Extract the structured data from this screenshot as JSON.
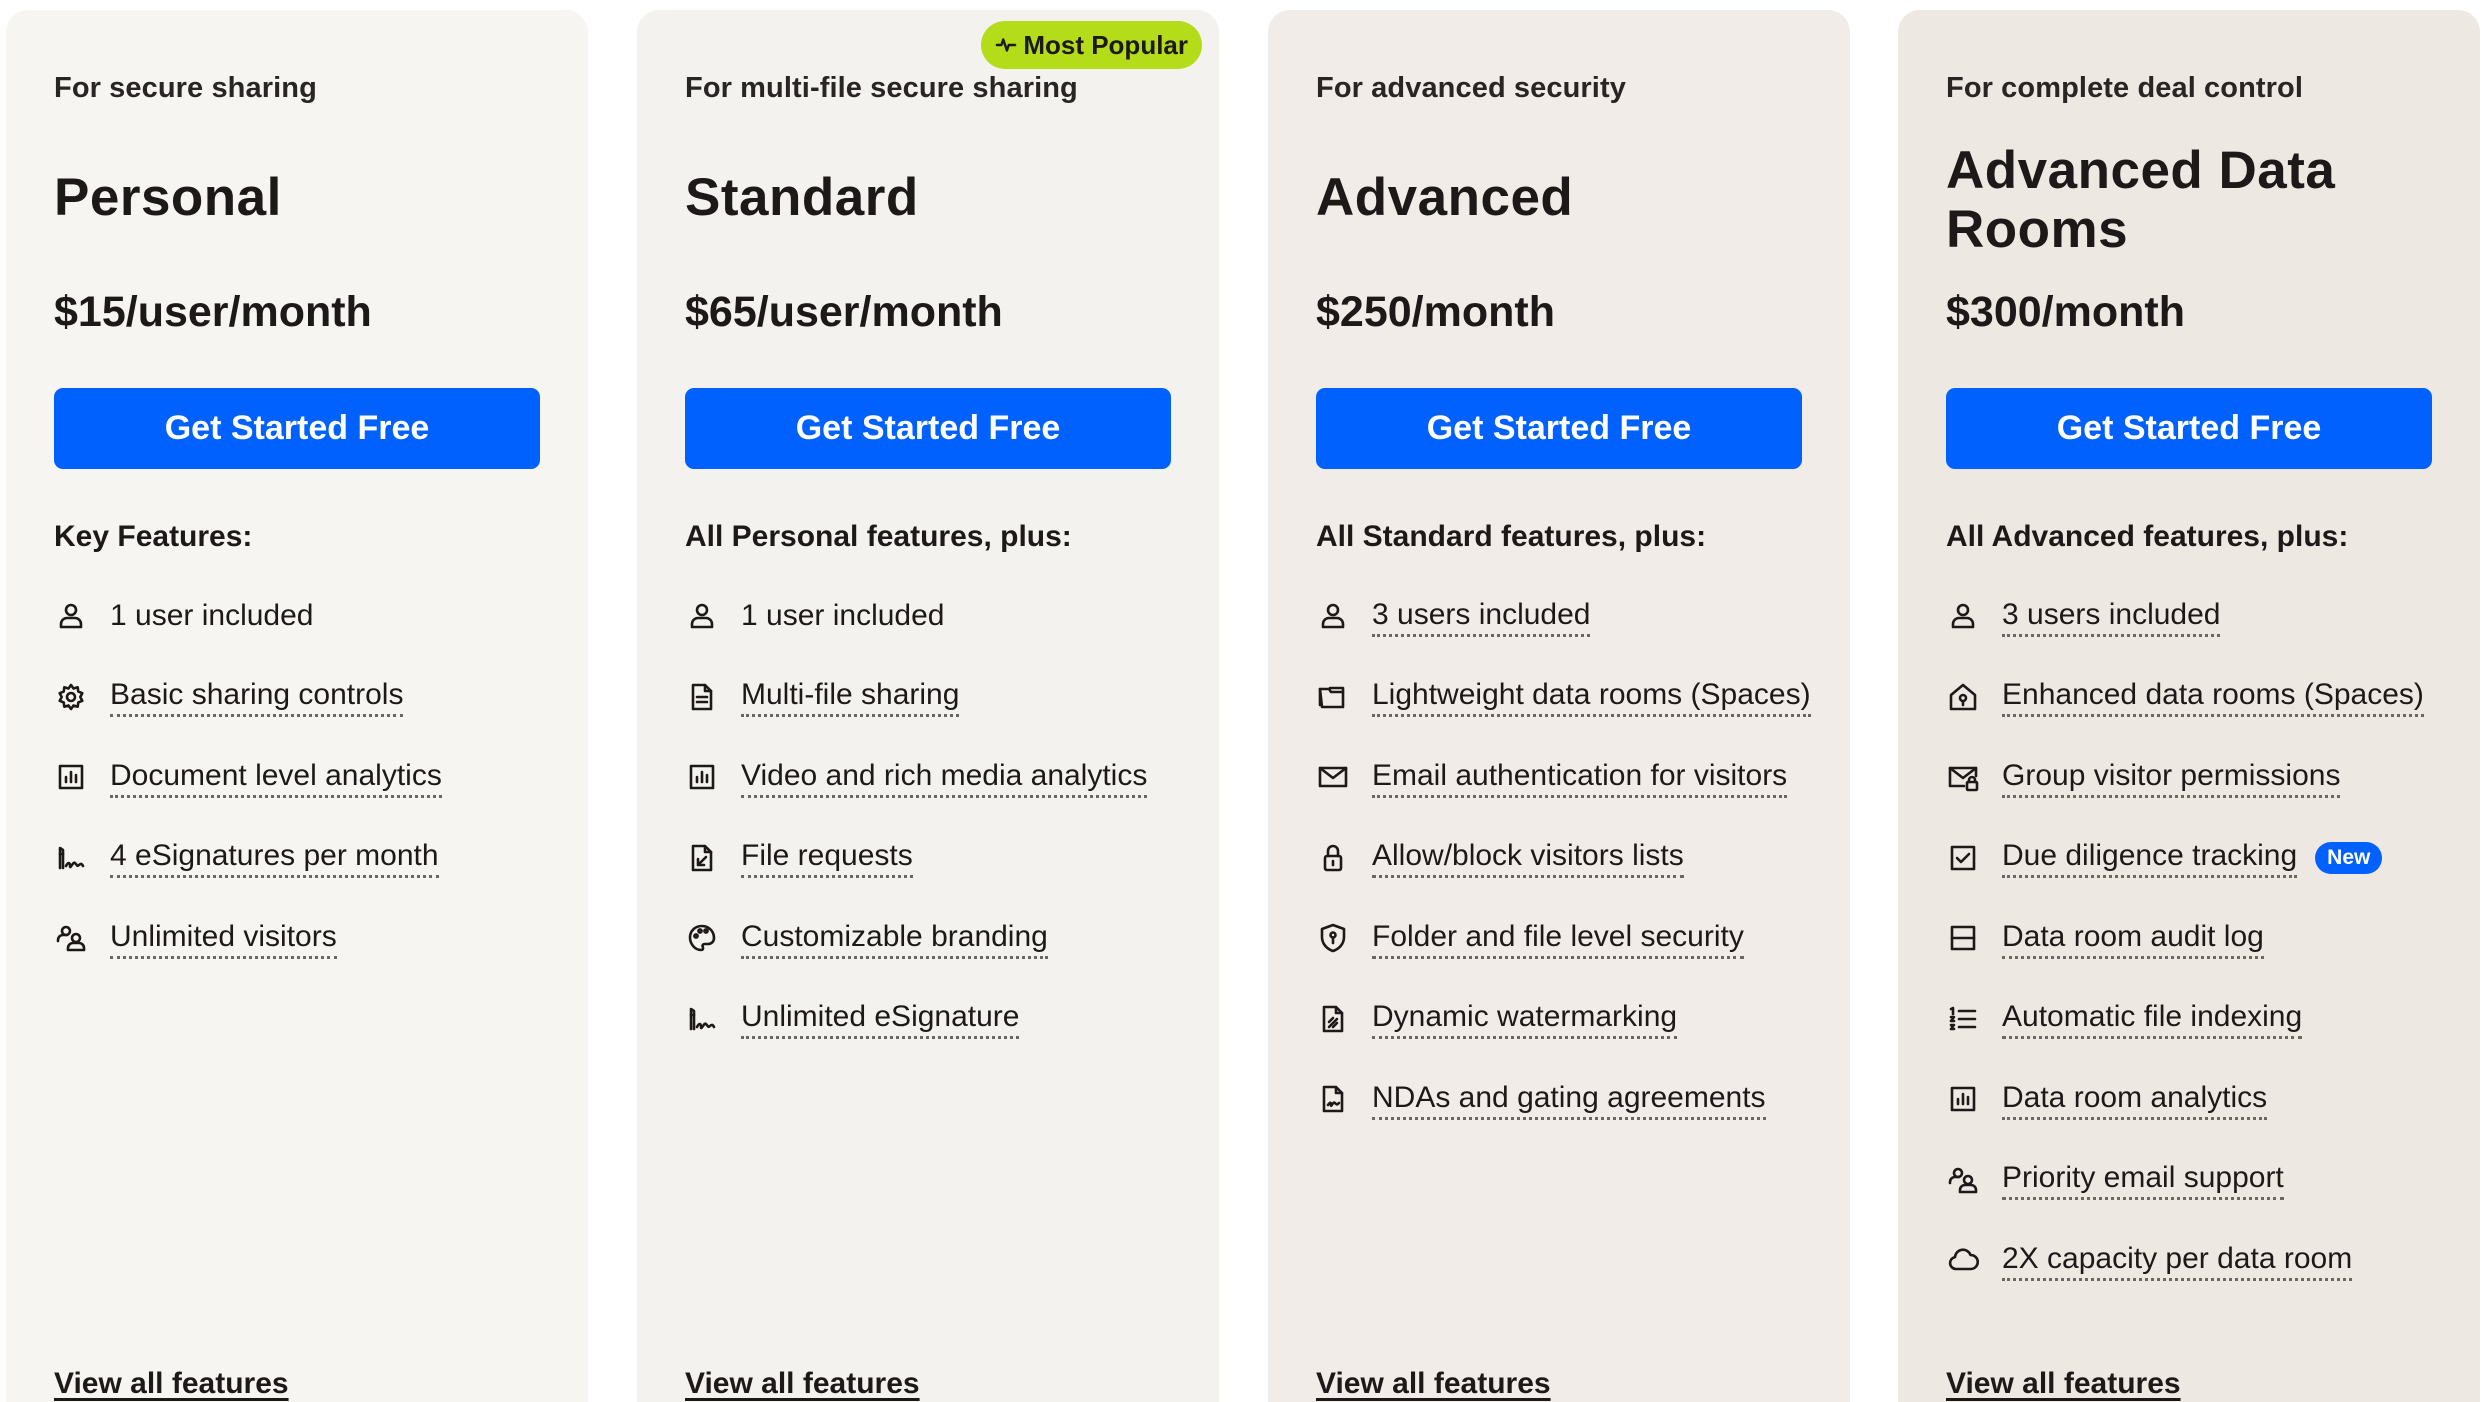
{
  "plans": [
    {
      "tagline": "For secure sharing",
      "name": "Personal",
      "price": "$15/user/month",
      "cta": "Get Started Free",
      "features_heading": "Key Features:",
      "features": [
        {
          "icon": "user-icon",
          "label": "1 user included"
        },
        {
          "icon": "gear-icon",
          "label": "Basic sharing controls"
        },
        {
          "icon": "bar-chart-icon",
          "label": "Document level analytics"
        },
        {
          "icon": "signature-icon",
          "label": "4 eSignatures per month"
        },
        {
          "icon": "users-icon",
          "label": "Unlimited visitors"
        }
      ],
      "view_all": "View all features"
    },
    {
      "tagline": "For multi-file secure sharing",
      "name": "Standard",
      "badge": "Most Popular",
      "price": "$65/user/month",
      "cta": "Get Started Free",
      "features_heading": "All Personal features, plus:",
      "features": [
        {
          "icon": "user-icon",
          "label": "1 user included"
        },
        {
          "icon": "document-icon",
          "label": "Multi-file sharing"
        },
        {
          "icon": "bar-chart-icon",
          "label": "Video and rich media analytics"
        },
        {
          "icon": "file-request-icon",
          "label": "File requests"
        },
        {
          "icon": "palette-icon",
          "label": "Customizable branding"
        },
        {
          "icon": "signature-icon",
          "label": "Unlimited eSignature"
        }
      ],
      "view_all": "View all features"
    },
    {
      "tagline": "For advanced security",
      "name": "Advanced",
      "price": "$250/month",
      "cta": "Get Started Free",
      "features_heading": "All Standard features, plus:",
      "features": [
        {
          "icon": "user-icon",
          "label": "3 users included"
        },
        {
          "icon": "folder-icon",
          "label": "Lightweight data rooms (Spaces)"
        },
        {
          "icon": "envelope-icon",
          "label": "Email authentication for visitors"
        },
        {
          "icon": "lock-icon",
          "label": "Allow/block visitors lists"
        },
        {
          "icon": "shield-icon",
          "label": "Folder and file level security"
        },
        {
          "icon": "watermark-icon",
          "label": "Dynamic watermarking"
        },
        {
          "icon": "nda-icon",
          "label": "NDAs and gating agreements"
        }
      ],
      "view_all": "View all features"
    },
    {
      "tagline": "For complete deal control",
      "name": "Advanced Data Rooms",
      "price": "$300/month",
      "cta": "Get Started Free",
      "features_heading": "All Advanced features, plus:",
      "features": [
        {
          "icon": "user-icon",
          "label": "3 users included"
        },
        {
          "icon": "data-room-icon",
          "label": "Enhanced data rooms (Spaces)"
        },
        {
          "icon": "envelope-lock-icon",
          "label": "Group visitor permissions"
        },
        {
          "icon": "checkbox-icon",
          "label": "Due diligence tracking",
          "badge": "New"
        },
        {
          "icon": "audit-log-icon",
          "label": "Data room audit log"
        },
        {
          "icon": "numbered-list-icon",
          "label": "Automatic file indexing"
        },
        {
          "icon": "bar-chart-icon",
          "label": "Data room analytics"
        },
        {
          "icon": "users-icon",
          "label": "Priority email support"
        },
        {
          "icon": "cloud-icon",
          "label": "2X capacity per data room"
        }
      ],
      "view_all": "View all features"
    }
  ],
  "colors": {
    "cta": "#0061fe",
    "badge_popular": "#b4dc19",
    "badge_new": "#0061fe",
    "text": "#1e1919"
  }
}
